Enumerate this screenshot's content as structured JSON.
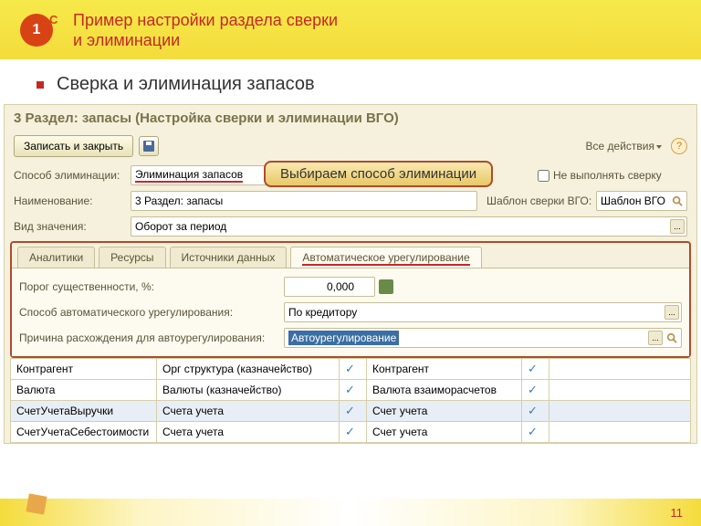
{
  "header": {
    "title_l1": "Пример настройки раздела сверки",
    "title_l2": "и элиминации",
    "logo_main": "1",
    "logo_side": "C"
  },
  "bullet": "Сверка и элиминация запасов",
  "form": {
    "title": "3 Раздел: запасы (Настройка сверки и элиминации ВГО)",
    "save_close": "Записать и закрыть",
    "all_actions": "Все действия",
    "lbl_elim": "Способ элиминации:",
    "val_elim": "Элиминация запасов",
    "chk_no_check": "Не выполнять сверку",
    "lbl_name": "Наименование:",
    "val_name": "3 Раздел: запасы",
    "lbl_template": "Шаблон сверки ВГО:",
    "val_template": "Шаблон ВГО",
    "lbl_kind": "Вид значения:",
    "val_kind": "Оборот за период"
  },
  "callout": "Выбираем способ элиминации",
  "tabs": {
    "t1": "Аналитики",
    "t2": "Ресурсы",
    "t3": "Источники данных",
    "t4": "Автоматическое урегулирование",
    "threshold_lbl": "Порог существенности, %:",
    "threshold_val": "0,000",
    "method_lbl": "Способ автоматического урегулирования:",
    "method_val": "По кредитору",
    "reason_lbl": "Причина расхождения для автоурегулирования:",
    "reason_val": "Автоурегулирование"
  },
  "table": {
    "rows": [
      {
        "c1": "Контрагент",
        "c2": "Орг структура (казначейство)",
        "c3": true,
        "c4": "Контрагент",
        "c5": true
      },
      {
        "c1": "Валюта",
        "c2": "Валюты (казначейство)",
        "c3": true,
        "c4": "Валюта взаиморасчетов",
        "c5": true
      },
      {
        "c1": "СчетУчетаВыручки",
        "c2": "Счета учета",
        "c3": true,
        "c4": "Счет учета",
        "c5": true
      },
      {
        "c1": "СчетУчетаСебестоимости",
        "c2": "Счета учета",
        "c3": true,
        "c4": "Счет учета",
        "c5": true
      }
    ]
  },
  "page": "11"
}
